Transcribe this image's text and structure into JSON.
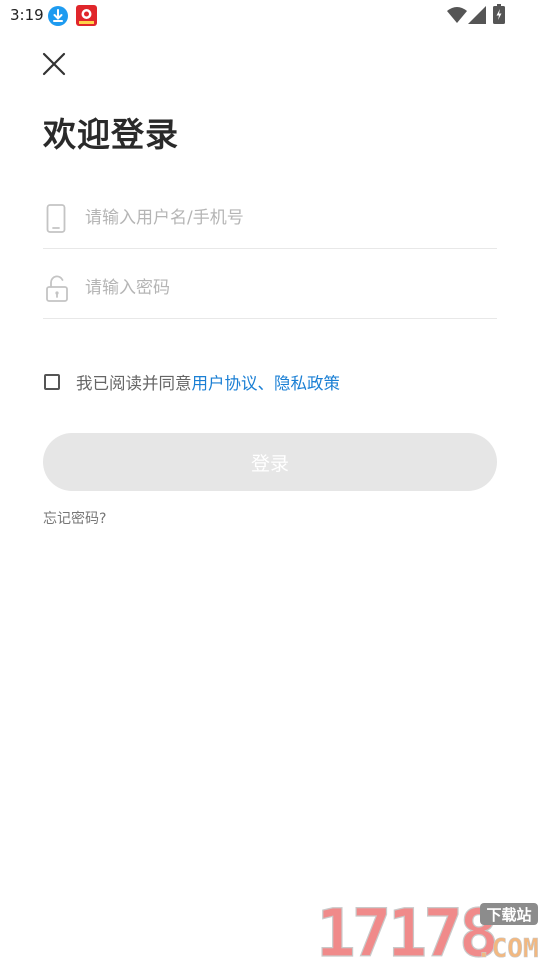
{
  "status_bar": {
    "time": "3:19",
    "icons": [
      "download-app-icon",
      "red-app-icon",
      "wifi-icon",
      "signal-icon",
      "battery-icon"
    ]
  },
  "close": {
    "icon": "close-icon"
  },
  "title": "欢迎登录",
  "username_field": {
    "placeholder": "请输入用户名/手机号",
    "value": "",
    "icon": "phone-icon"
  },
  "password_field": {
    "placeholder": "请输入密码",
    "value": "",
    "icon": "lock-icon"
  },
  "agreement": {
    "checked": false,
    "prefix": "我已阅读并同意",
    "user_agreement": "用户协议",
    "separator": "、",
    "privacy_policy": "隐私政策"
  },
  "login_button": "登录",
  "forgot_password": "忘记密码?",
  "watermark": {
    "digits": "17178",
    "site_label": "下载站",
    "domain": ".COM"
  },
  "colors": {
    "link": "#1a7fd4",
    "title": "#2a2a2a",
    "placeholder": "#b5b5b5",
    "button_disabled": "#e6e6e6",
    "divider": "#e8e8e8"
  }
}
